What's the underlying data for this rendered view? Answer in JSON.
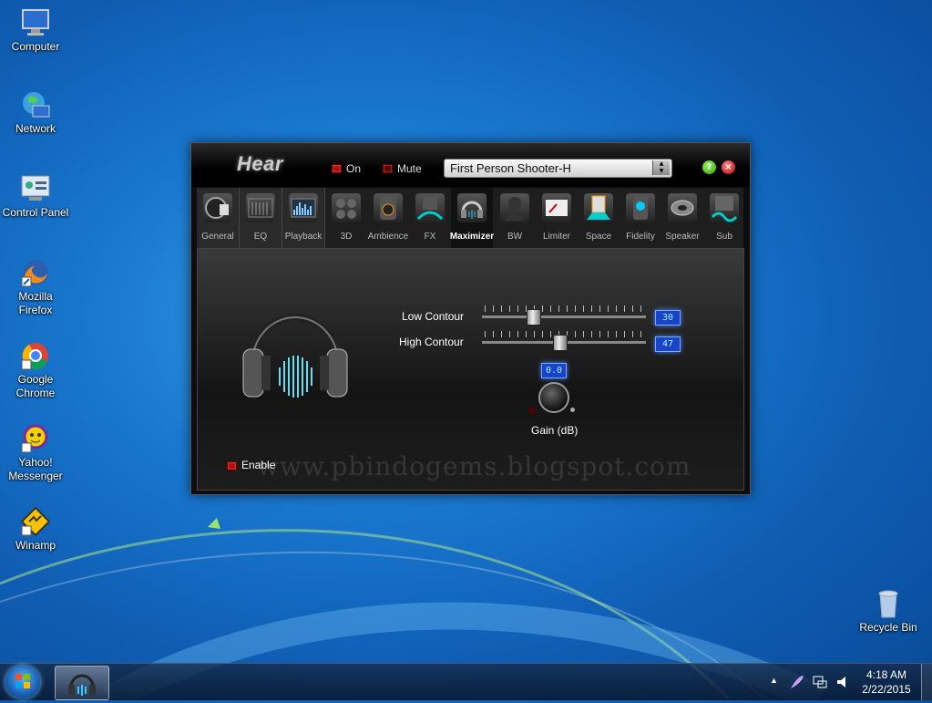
{
  "desktop": {
    "icons": [
      {
        "label_line1": "Computer",
        "label_line2": "",
        "icon": "computer-icon"
      },
      {
        "label_line1": "Network",
        "label_line2": "",
        "icon": "network-icon"
      },
      {
        "label_line1": "Control Panel",
        "label_line2": "",
        "icon": "control-panel-icon"
      },
      {
        "label_line1": "Mozilla",
        "label_line2": "Firefox",
        "icon": "firefox-icon"
      },
      {
        "label_line1": "Google",
        "label_line2": "Chrome",
        "icon": "chrome-icon"
      },
      {
        "label_line1": "Yahoo!",
        "label_line2": "Messenger",
        "icon": "yahoo-messenger-icon"
      },
      {
        "label_line1": "Winamp",
        "label_line2": "",
        "icon": "winamp-icon"
      }
    ],
    "recycle_bin": "Recycle Bin"
  },
  "app": {
    "title": "Hear",
    "on_label": "On",
    "mute_label": "Mute",
    "preset": "First Person Shooter-H",
    "help_glyph": "?",
    "close_glyph": "×",
    "tabs": [
      {
        "label": "General"
      },
      {
        "label": "EQ"
      },
      {
        "label": "Playback"
      },
      {
        "label": "3D"
      },
      {
        "label": "Ambience"
      },
      {
        "label": "FX"
      },
      {
        "label": "Maximizer"
      },
      {
        "label": "BW"
      },
      {
        "label": "Limiter"
      },
      {
        "label": "Space"
      },
      {
        "label": "Fidelity"
      },
      {
        "label": "Speaker"
      },
      {
        "label": "Sub"
      }
    ],
    "active_tab": "Maximizer",
    "maximizer": {
      "low_contour_label": "Low Contour",
      "low_contour_value": "30",
      "high_contour_label": "High Contour",
      "high_contour_value": "47",
      "gain_value": "0.0",
      "gain_label": "Gain (dB)",
      "enable_label": "Enable"
    },
    "watermark": "www.pbindogems.blogspot.com"
  },
  "taskbar": {
    "time": "4:18 AM",
    "date": "2/22/2015",
    "show_hidden_glyph": "▲"
  },
  "colors": {
    "led_red": "#b01010",
    "lcd_blue": "#1844c8",
    "desktop_blue": "#1a78cf"
  }
}
